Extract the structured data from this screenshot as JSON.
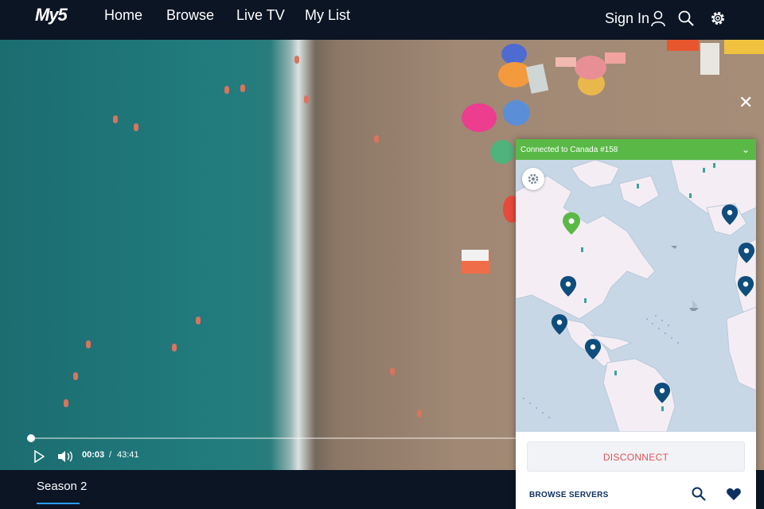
{
  "header": {
    "logo": "My5",
    "nav": [
      "Home",
      "Browse",
      "Live TV",
      "My List"
    ],
    "sign_in": "Sign In"
  },
  "player": {
    "current_time": "00:03",
    "separator": "/",
    "duration": "43:41",
    "progress": 0.001
  },
  "bottom": {
    "season_tab": "Season 2"
  },
  "vpn": {
    "status": "Connected to Canada #158",
    "status_color": "#5ab946",
    "disconnect_label": "DISCONNECT",
    "browse_label": "BROWSE SERVERS"
  },
  "icons": [
    "user-icon",
    "search-icon",
    "settings-gear-icon",
    "close-icon",
    "play-icon",
    "volume-icon",
    "chevron-down-icon",
    "map-settings-icon",
    "location-pin-icon",
    "heart-icon"
  ]
}
